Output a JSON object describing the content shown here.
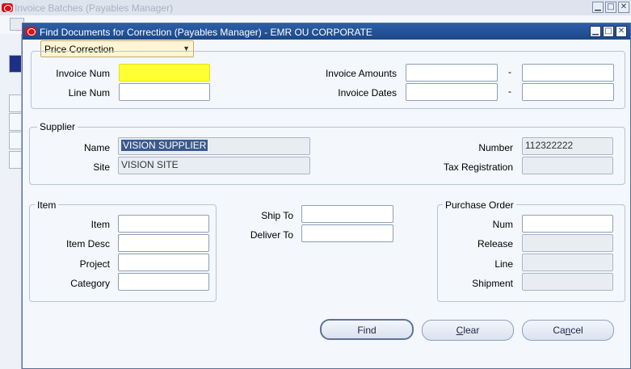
{
  "background_window": {
    "title": "Invoice Batches (Payables Manager)"
  },
  "dialog": {
    "title": "Find Documents for Correction (Payables Manager) - EMR OU CORPORATE",
    "correction_type": "Price Correction",
    "invoice": {
      "invoice_num_label": "Invoice Num",
      "invoice_num_value": "",
      "line_num_label": "Line Num",
      "line_num_value": "",
      "invoice_amounts_label": "Invoice Amounts",
      "invoice_dates_label": "Invoice Dates",
      "range_separator": "-"
    },
    "supplier": {
      "group_label": "Supplier",
      "name_label": "Name",
      "name_value": "VISION SUPPLIER",
      "site_label": "Site",
      "site_value": "VISION SITE",
      "number_label": "Number",
      "number_value": "112322222",
      "tax_registration_label": "Tax Registration",
      "tax_registration_value": ""
    },
    "item": {
      "group_label": "Item",
      "item_label": "Item",
      "item_desc_label": "Item Desc",
      "project_label": "Project",
      "category_label": "Category"
    },
    "ship": {
      "ship_to_label": "Ship To",
      "deliver_to_label": "Deliver To"
    },
    "purchase_order": {
      "group_label": "Purchase Order",
      "num_label": "Num",
      "release_label": "Release",
      "line_label": "Line",
      "shipment_label": "Shipment"
    },
    "buttons": {
      "find": "Find",
      "clear_first": "C",
      "clear_rest": "lear",
      "cancel_first": "Ca",
      "cancel_mn": "n",
      "cancel_rest": "cel"
    }
  },
  "window_controls": {
    "minimize": "▁",
    "maximize": "□",
    "close": "✕"
  },
  "colors": {
    "highlight": "#ffff33",
    "titlebar": "#1c4889",
    "oracle_red": "#d2141b"
  }
}
